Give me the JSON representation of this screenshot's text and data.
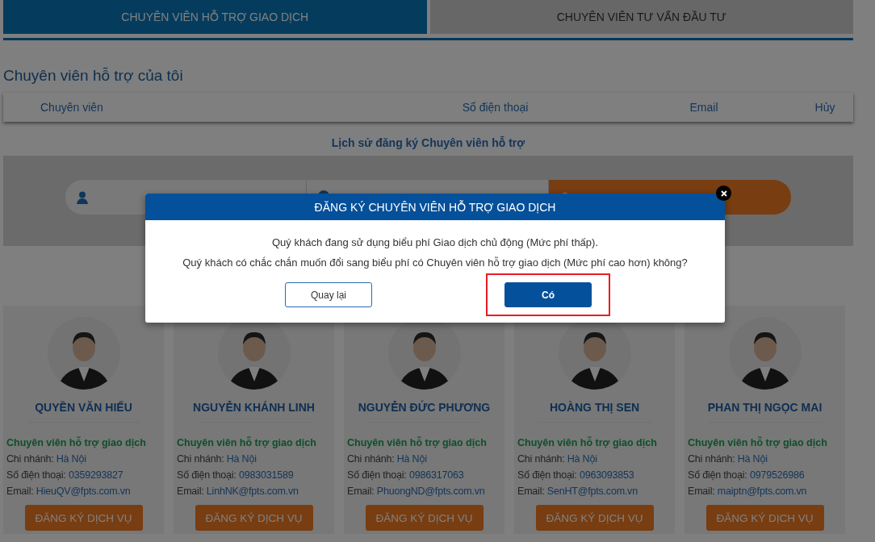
{
  "tabs": [
    {
      "label": "CHUYÊN VIÊN HỖ TRỢ GIAO DỊCH",
      "selected": true
    },
    {
      "label": "CHUYÊN VIÊN TƯ VẤN ĐẦU TƯ",
      "selected": false
    }
  ],
  "my_specialist": {
    "title": "Chuyên viên hỗ trợ của tôi",
    "columns": [
      "Chuyên viên",
      "Số điện thoại",
      "Email",
      "Hủy"
    ]
  },
  "history_title": "Lịch sử đăng ký Chuyên viên hỗ trợ",
  "specialists": [
    {
      "name": "QUYỀN VĂN HIẾU",
      "role": "Chuyên viên hỗ trợ giao dịch",
      "lines": [
        {
          "label": "Chi nhánh: ",
          "value": "Hà Nội"
        },
        {
          "label": "Số điện thoại: ",
          "value": "0359293827"
        },
        {
          "label": "Email: ",
          "value": "HieuQV@fpts.com.vn"
        }
      ],
      "button": "ĐĂNG KÝ DỊCH VỤ"
    },
    {
      "name": "NGUYỄN KHÁNH LINH",
      "role": "Chuyên viên hỗ trợ giao dịch",
      "lines": [
        {
          "label": "Chi nhánh: ",
          "value": "Hà Nội"
        },
        {
          "label": "Số điện thoại: ",
          "value": "0983031589"
        },
        {
          "label": "Email: ",
          "value": "LinhNK@fpts.com.vn"
        }
      ],
      "button": "ĐĂNG KÝ DỊCH VỤ"
    },
    {
      "name": "NGUYỄN ĐỨC PHƯƠNG",
      "role": "Chuyên viên hỗ trợ giao dịch",
      "lines": [
        {
          "label": "Chi nhánh: ",
          "value": "Hà Nội"
        },
        {
          "label": "Số điện thoại: ",
          "value": "0986317063"
        },
        {
          "label": "Email: ",
          "value": "PhuongND@fpts.com.vn"
        }
      ],
      "button": "ĐĂNG KÝ DỊCH VỤ"
    },
    {
      "name": "HOÀNG THỊ SEN",
      "role": "Chuyên viên hỗ trợ giao dịch",
      "lines": [
        {
          "label": "Chi nhánh: ",
          "value": "Hà Nội"
        },
        {
          "label": "Số điện thoại: ",
          "value": "0963093853"
        },
        {
          "label": "Email: ",
          "value": "SenHT@fpts.com.vn"
        }
      ],
      "button": "ĐĂNG KÝ DỊCH VỤ"
    },
    {
      "name": "PHAN THỊ NGỌC MAI",
      "role": "Chuyên viên hỗ trợ giao dịch",
      "lines": [
        {
          "label": "Chi nhánh: ",
          "value": "Hà Nội"
        },
        {
          "label": "Số điện thoại: ",
          "value": "0979526986"
        },
        {
          "label": "Email: ",
          "value": "maiptn@fpts.com.vn"
        }
      ],
      "button": "ĐĂNG KÝ DỊCH VỤ"
    }
  ],
  "dialog": {
    "title": "ĐĂNG KÝ CHUYÊN VIÊN HỖ TRỢ GIAO DỊCH",
    "message": [
      "Quý khách đang sử dụng biểu phí Giao dịch chủ động (Mức phí thấp).",
      "Quý khách có chắc chắn muốn đổi sang biểu phí có Chuyên viên hỗ trợ giao dịch (Mức phí cao hơn) không?"
    ],
    "buttons": [
      {
        "label": "Quay lại",
        "kind": "outline",
        "highlighted": false
      },
      {
        "label": "Có",
        "kind": "primary",
        "highlighted": true
      }
    ]
  }
}
